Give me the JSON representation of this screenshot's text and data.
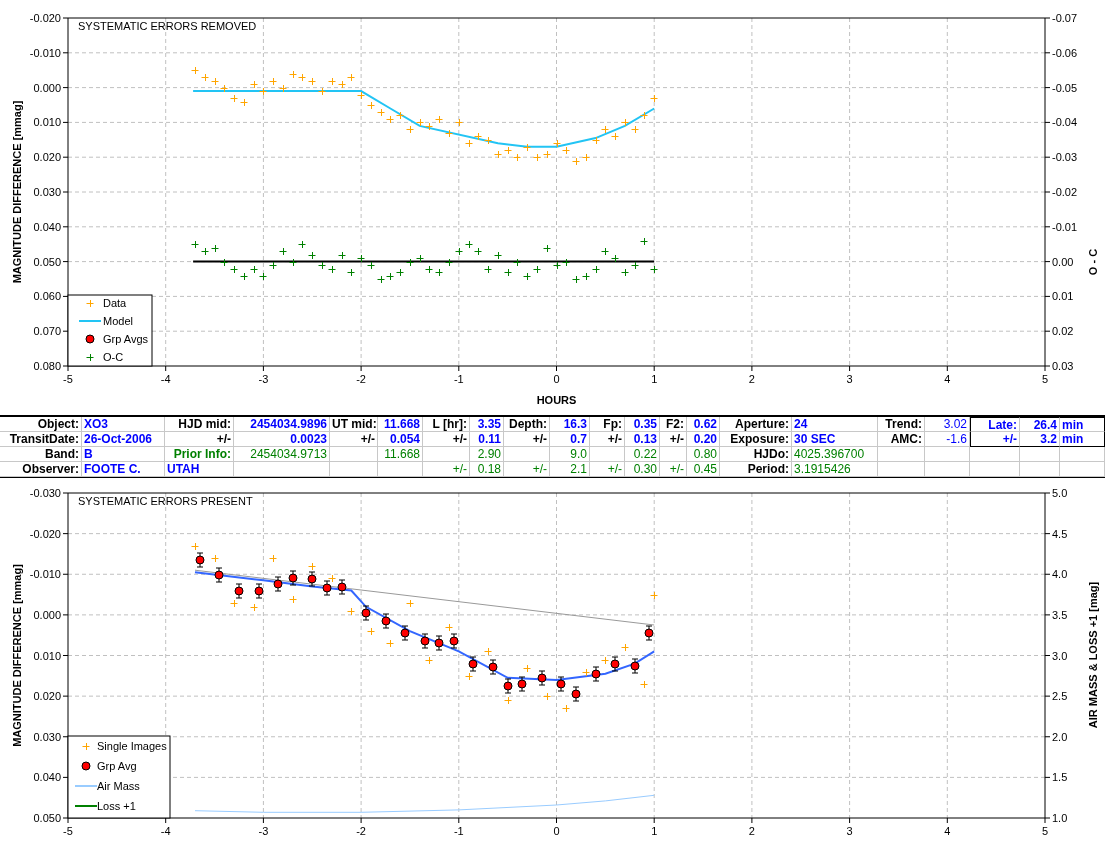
{
  "top_panel": {
    "chart_data": {
      "type": "scatter",
      "title": "SYSTEMATIC ERRORS REMOVED",
      "xlabel": "HOURS",
      "ylabel": "MAGNITUDE DIFFERENCE [mmag]",
      "y2label": "O - C",
      "xlim": [
        -5,
        5
      ],
      "ylim": [
        0.08,
        -0.02
      ],
      "y2lim": [
        0.03,
        -0.07
      ],
      "grid": true,
      "legend": true,
      "xticks": [
        -5,
        -4,
        -3,
        -2,
        -1,
        0,
        1,
        2,
        3,
        4,
        5
      ],
      "yticks": [
        {
          "value": -0.02,
          "label": "-0.020"
        },
        {
          "value": -0.01,
          "label": "-0.010"
        },
        {
          "value": 0,
          "label": "0.000"
        },
        {
          "value": 0.01,
          "label": "0.010"
        },
        {
          "value": 0.02,
          "label": "0.020"
        },
        {
          "value": 0.03,
          "label": "0.030"
        },
        {
          "value": 0.04,
          "label": "0.040"
        },
        {
          "value": 0.05,
          "label": "0.050"
        },
        {
          "value": 0.06,
          "label": "0.060"
        },
        {
          "value": 0.07,
          "label": "0.070"
        },
        {
          "value": 0.08,
          "label": "0.080"
        }
      ],
      "y2ticks": [
        {
          "value": -0.07,
          "label": "-0.07"
        },
        {
          "value": -0.06,
          "label": "-0.06"
        },
        {
          "value": -0.05,
          "label": "-0.05"
        },
        {
          "value": -0.04,
          "label": "-0.04"
        },
        {
          "value": -0.03,
          "label": "-0.03"
        },
        {
          "value": -0.02,
          "label": "-0.02"
        },
        {
          "value": -0.01,
          "label": "-0.01"
        },
        {
          "value": 0,
          "label": "0.00"
        },
        {
          "value": 0.01,
          "label": "0.01"
        },
        {
          "value": 0.02,
          "label": "0.02"
        },
        {
          "value": 0.03,
          "label": "0.03"
        }
      ],
      "x": [
        -3.7,
        -3.6,
        -3.5,
        -3.4,
        -3.3,
        -3.2,
        -3.1,
        -3.0,
        -2.9,
        -2.8,
        -2.7,
        -2.6,
        -2.5,
        -2.4,
        -2.3,
        -2.2,
        -2.1,
        -2.0,
        -1.9,
        -1.8,
        -1.7,
        -1.6,
        -1.5,
        -1.4,
        -1.3,
        -1.2,
        -1.1,
        -1.0,
        -0.9,
        -0.8,
        -0.7,
        -0.6,
        -0.5,
        -0.4,
        -0.3,
        -0.2,
        -0.1,
        0.0,
        0.1,
        0.2,
        0.3,
        0.4,
        0.5,
        0.6,
        0.7,
        0.8,
        0.9,
        1.0
      ],
      "series": [
        {
          "name": "Data",
          "type": "scatter",
          "marker": "cross",
          "color": "#ffa500",
          "values": [
            -0.005,
            -0.003,
            -0.002,
            0.0,
            0.003,
            0.004,
            -0.001,
            0.001,
            -0.002,
            0.0,
            -0.004,
            -0.003,
            -0.002,
            0.001,
            -0.002,
            -0.001,
            -0.003,
            0.002,
            0.005,
            0.007,
            0.009,
            0.008,
            0.012,
            0.01,
            0.011,
            0.009,
            0.013,
            0.01,
            0.016,
            0.014,
            0.015,
            0.019,
            0.018,
            0.02,
            0.017,
            0.02,
            0.019,
            0.016,
            0.018,
            0.021,
            0.02,
            0.015,
            0.012,
            0.014,
            0.01,
            0.012,
            0.008,
            0.003
          ]
        },
        {
          "name": "Model",
          "type": "line",
          "color": "#22c4f4",
          "x": [
            -3.72,
            -2.0,
            -1.7,
            -1.4,
            -0.6,
            -0.3,
            0.0,
            0.4,
            0.7,
            1.0
          ],
          "values": [
            0.001,
            0.001,
            0.006,
            0.011,
            0.016,
            0.017,
            0.017,
            0.0145,
            0.011,
            0.006
          ]
        },
        {
          "name": "Grp Avgs",
          "type": "scatter",
          "marker": "circle",
          "color": "#ff0000",
          "values": [
            null,
            null,
            null,
            null,
            null,
            null,
            null,
            null,
            null,
            null,
            null,
            null,
            null,
            null,
            null,
            null,
            null,
            null,
            null,
            null,
            null,
            null,
            null,
            null,
            null,
            null,
            null,
            null,
            null,
            null,
            null,
            null,
            null,
            null,
            null,
            null,
            null,
            null,
            null,
            null,
            null,
            null,
            null,
            null,
            null,
            null,
            null,
            null
          ]
        },
        {
          "name": "O-C",
          "type": "scatter",
          "marker": "cross",
          "axis": "y2",
          "color": "#008000",
          "values": [
            -0.005,
            -0.003,
            -0.004,
            0.0,
            0.002,
            0.004,
            0.002,
            0.004,
            0.001,
            -0.003,
            0.0,
            -0.005,
            -0.002,
            0.001,
            0.002,
            -0.002,
            0.003,
            -0.001,
            0.001,
            0.005,
            0.004,
            0.003,
            0.0,
            -0.001,
            0.002,
            0.003,
            0.0,
            -0.003,
            -0.005,
            -0.003,
            0.002,
            -0.002,
            0.003,
            0.0,
            0.004,
            0.002,
            -0.004,
            0.001,
            0.0,
            0.005,
            0.004,
            0.002,
            -0.003,
            -0.001,
            0.003,
            0.001,
            -0.006,
            0.002
          ]
        },
        {
          "type": "line",
          "axis": "y2",
          "color": "#000000",
          "x": [
            -3.72,
            1.0
          ],
          "values": [
            0,
            0
          ]
        }
      ]
    }
  },
  "info_table": {
    "rows": [
      [
        {
          "text": "Object:",
          "kind": "label"
        },
        {
          "text": "XO3",
          "kind": "value"
        },
        {
          "text": "HJD mid:",
          "kind": "label"
        },
        {
          "text": "2454034.9896",
          "kind": "value"
        },
        {
          "text": "UT mid:",
          "kind": "label"
        },
        {
          "text": "11.668",
          "kind": "value"
        },
        {
          "text": "L [hr]:",
          "kind": "label"
        },
        {
          "text": "3.35",
          "kind": "value"
        },
        {
          "text": "Depth:",
          "kind": "label"
        },
        {
          "text": "16.3",
          "kind": "value"
        },
        {
          "text": "Fp:",
          "kind": "label"
        },
        {
          "text": "0.35",
          "kind": "value"
        },
        {
          "text": "F2:",
          "kind": "label"
        },
        {
          "text": "0.62",
          "kind": "value"
        },
        {
          "text": "Aperture:",
          "kind": "label"
        },
        {
          "text": "24",
          "kind": "value"
        },
        {
          "text": "Trend:",
          "kind": "label"
        },
        {
          "text": "3.02",
          "kind": "plain"
        },
        {
          "text": "Late:",
          "kind": "value"
        },
        {
          "text": "26.4",
          "kind": "value"
        },
        {
          "text": "min",
          "kind": "value"
        }
      ],
      [
        {
          "text": "TransitDate:",
          "kind": "label"
        },
        {
          "text": "26-Oct-2006",
          "kind": "value"
        },
        {
          "text": "+/-",
          "kind": "label"
        },
        {
          "text": "0.0023",
          "kind": "value"
        },
        {
          "text": "+/-",
          "kind": "label"
        },
        {
          "text": "0.054",
          "kind": "value"
        },
        {
          "text": "+/-",
          "kind": "label"
        },
        {
          "text": "0.11",
          "kind": "value"
        },
        {
          "text": "+/-",
          "kind": "label"
        },
        {
          "text": "0.7",
          "kind": "value"
        },
        {
          "text": "+/-",
          "kind": "label"
        },
        {
          "text": "0.13",
          "kind": "value"
        },
        {
          "text": "+/-",
          "kind": "label"
        },
        {
          "text": "0.20",
          "kind": "value"
        },
        {
          "text": "Exposure:",
          "kind": "label"
        },
        {
          "text": "30 SEC",
          "kind": "value"
        },
        {
          "text": "AMC:",
          "kind": "label"
        },
        {
          "text": "-1.6",
          "kind": "plain"
        },
        {
          "text": "+/-",
          "kind": "value"
        },
        {
          "text": "3.2",
          "kind": "value"
        },
        {
          "text": "min",
          "kind": "value"
        }
      ],
      [
        {
          "text": "Band:",
          "kind": "label"
        },
        {
          "text": "B",
          "kind": "value"
        },
        {
          "text": "Prior Info:",
          "kind": "prior_label"
        },
        {
          "text": "2454034.9713",
          "kind": "prior"
        },
        null,
        {
          "text": "11.668",
          "kind": "prior"
        },
        null,
        {
          "text": "2.90",
          "kind": "prior"
        },
        null,
        {
          "text": "9.0",
          "kind": "prior"
        },
        null,
        {
          "text": "0.22",
          "kind": "prior"
        },
        null,
        {
          "text": "0.80",
          "kind": "prior"
        },
        {
          "text": "HJDo:",
          "kind": "label"
        },
        {
          "text": "4025.396700",
          "kind": "prior"
        },
        null,
        null,
        null,
        null,
        null
      ],
      [
        {
          "text": "Observer:",
          "kind": "label"
        },
        {
          "text": "FOOTE C.",
          "kind": "value"
        },
        {
          "text": "UTAH",
          "kind": "value"
        },
        null,
        null,
        null,
        {
          "text": "+/-",
          "kind": "prior"
        },
        {
          "text": "0.18",
          "kind": "prior"
        },
        {
          "text": "+/-",
          "kind": "prior"
        },
        {
          "text": "2.1",
          "kind": "prior"
        },
        {
          "text": "+/-",
          "kind": "prior"
        },
        {
          "text": "0.30",
          "kind": "prior"
        },
        {
          "text": "+/-",
          "kind": "prior"
        },
        {
          "text": "0.45",
          "kind": "prior"
        },
        {
          "text": "Period:",
          "kind": "label"
        },
        {
          "text": "3.1915426",
          "kind": "prior"
        },
        null,
        null,
        null,
        null,
        null
      ]
    ]
  },
  "bottom_panel": {
    "chart_data": {
      "type": "scatter",
      "title": "SYSTEMATIC ERRORS PRESENT",
      "ylabel": "MAGNITUDE DIFFERENCE [mmag]",
      "y2label": "AIR MASS & LOSS +1 [mag]",
      "xlim": [
        -5,
        5
      ],
      "ylim": [
        0.05,
        -0.03
      ],
      "y2lim": [
        1.0,
        5.0
      ],
      "grid": true,
      "legend": true,
      "xticks": [
        -5,
        -4,
        -3,
        -2,
        -1,
        0,
        1,
        2,
        3,
        4,
        5
      ],
      "yticks": [
        {
          "value": -0.03,
          "label": "-0.030"
        },
        {
          "value": -0.02,
          "label": "-0.020"
        },
        {
          "value": -0.01,
          "label": "-0.010"
        },
        {
          "value": 0,
          "label": "0.000"
        },
        {
          "value": 0.01,
          "label": "0.010"
        },
        {
          "value": 0.02,
          "label": "0.020"
        },
        {
          "value": 0.03,
          "label": "0.030"
        },
        {
          "value": 0.04,
          "label": "0.040"
        },
        {
          "value": 0.05,
          "label": "0.050"
        }
      ],
      "y2ticks": [
        {
          "value": 5.0,
          "label": "5.0"
        },
        {
          "value": 4.5,
          "label": "4.5"
        },
        {
          "value": 4.0,
          "label": "4.0"
        },
        {
          "value": 3.5,
          "label": "3.5"
        },
        {
          "value": 3.0,
          "label": "3.0"
        },
        {
          "value": 2.5,
          "label": "2.5"
        },
        {
          "value": 2.0,
          "label": "2.0"
        },
        {
          "value": 1.5,
          "label": "1.5"
        },
        {
          "value": 1.0,
          "label": "1.0"
        }
      ],
      "x": [
        -3.7,
        -3.5,
        -3.3,
        -3.1,
        -2.9,
        -2.7,
        -2.5,
        -2.3,
        -2.1,
        -1.9,
        -1.7,
        -1.5,
        -1.3,
        -1.1,
        -0.9,
        -0.7,
        -0.5,
        -0.3,
        -0.1,
        0.1,
        0.3,
        0.5,
        0.7,
        0.9,
        1.0
      ],
      "series": [
        {
          "name": "Single Images",
          "type": "scatter",
          "marker": "cross",
          "color": "#ffa500",
          "values": [
            -0.017,
            -0.014,
            -0.003,
            -0.002,
            -0.014,
            -0.004,
            -0.012,
            -0.009,
            -0.001,
            0.004,
            0.007,
            -0.003,
            0.011,
            0.003,
            0.015,
            0.009,
            0.021,
            0.013,
            0.02,
            0.023,
            0.014,
            0.011,
            0.008,
            0.017,
            -0.005
          ]
        },
        {
          "name": "Grp Avg",
          "type": "scatter",
          "marker": "circle",
          "color": "#ff0000",
          "x": [
            -3.65,
            -3.45,
            -3.25,
            -3.05,
            -2.85,
            -2.7,
            -2.5,
            -2.35,
            -2.2,
            -1.95,
            -1.75,
            -1.55,
            -1.35,
            -1.2,
            -1.05,
            -0.85,
            -0.65,
            -0.5,
            -0.35,
            -0.15,
            0.05,
            0.2,
            0.4,
            0.6,
            0.8,
            0.95
          ],
          "values": [
            -0.0135,
            -0.0098,
            -0.006,
            -0.006,
            -0.0075,
            -0.009,
            -0.0088,
            -0.0065,
            -0.0068,
            -0.0005,
            0.0015,
            0.0045,
            0.0065,
            0.007,
            0.0065,
            0.012,
            0.0128,
            0.0175,
            0.017,
            0.0155,
            0.017,
            0.0195,
            0.0145,
            0.012,
            0.0125,
            0.0045
          ]
        },
        {
          "name": "Air Mass",
          "type": "line",
          "axis": "y2",
          "color": "#99ccff",
          "x": [
            -3.7,
            -3.0,
            -2.0,
            -1.0,
            0.0,
            0.5,
            1.0
          ],
          "values": [
            1.09,
            1.07,
            1.07,
            1.1,
            1.16,
            1.21,
            1.28
          ]
        },
        {
          "name": "Loss +1",
          "type": "line",
          "color": "#008000",
          "values": [
            null,
            null,
            null,
            null,
            null,
            null,
            null,
            null,
            null,
            null,
            null,
            null,
            null,
            null,
            null,
            null,
            null,
            null,
            null,
            null,
            null,
            null,
            null,
            null,
            null
          ]
        },
        {
          "type": "line",
          "color": "#999999",
          "x": [
            -3.7,
            1.0
          ],
          "values": [
            -0.011,
            0.0025
          ]
        },
        {
          "type": "line",
          "color": "#3366ff",
          "x": [
            -3.7,
            -3.0,
            -2.5,
            -2.1,
            -1.95,
            -1.5,
            -1.0,
            -0.5,
            0.0,
            0.5,
            0.8,
            1.0
          ],
          "values": [
            -0.0105,
            -0.0085,
            -0.007,
            -0.006,
            -0.002,
            0.004,
            0.009,
            0.0155,
            0.016,
            0.0145,
            0.012,
            0.009
          ]
        }
      ]
    }
  }
}
